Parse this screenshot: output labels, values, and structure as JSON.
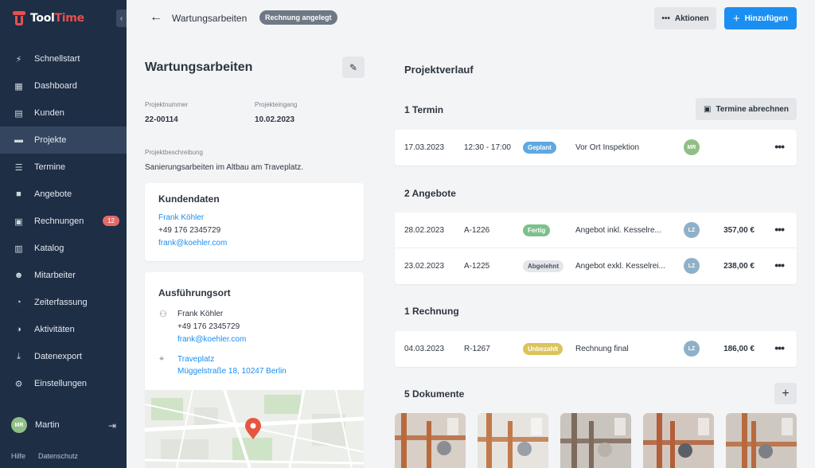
{
  "app": {
    "name_part1": "Tool",
    "name_part2": "Time",
    "brand_color": "#e84f4f",
    "accent_color": "#1b8ef2"
  },
  "sidebar": {
    "items": [
      {
        "label": "Schnellstart",
        "icon": "bolt-icon",
        "glyph": "⚡",
        "active": false
      },
      {
        "label": "Dashboard",
        "icon": "dashboard-icon",
        "glyph": "▦",
        "active": false
      },
      {
        "label": "Kunden",
        "icon": "address-card-icon",
        "glyph": "▤",
        "active": false
      },
      {
        "label": "Projekte",
        "icon": "folder-icon",
        "glyph": "▬",
        "active": true
      },
      {
        "label": "Termine",
        "icon": "list-icon",
        "glyph": "☰",
        "active": false
      },
      {
        "label": "Angebote",
        "icon": "document-icon",
        "glyph": "■",
        "active": false
      },
      {
        "label": "Rechnungen",
        "icon": "invoice-icon",
        "glyph": "▣",
        "active": false,
        "badge": "12"
      },
      {
        "label": "Katalog",
        "icon": "book-icon",
        "glyph": "▥",
        "active": false
      },
      {
        "label": "Mitarbeiter",
        "icon": "users-icon",
        "glyph": "☻",
        "active": false
      },
      {
        "label": "Zeiterfassung",
        "icon": "stopwatch-icon",
        "glyph": "◔",
        "active": false
      },
      {
        "label": "Aktivitäten",
        "icon": "activity-icon",
        "glyph": "◑",
        "active": false
      },
      {
        "label": "Datenexport",
        "icon": "download-icon",
        "glyph": "⤓",
        "active": false
      },
      {
        "label": "Einstellungen",
        "icon": "gear-icon",
        "glyph": "⚙",
        "active": false
      }
    ],
    "user": {
      "initials": "MR",
      "name": "Martin"
    },
    "footer": {
      "help": "Hilfe",
      "privacy": "Datenschutz"
    }
  },
  "header": {
    "title": "Wartungsarbeiten",
    "status": "Rechnung angelegt",
    "actions_label": "Aktionen",
    "add_label": "Hinzufügen"
  },
  "project": {
    "title": "Wartungsarbeiten",
    "number_label": "Projektnummer",
    "number": "22-00114",
    "received_label": "Projekteingang",
    "received": "10.02.2023",
    "description_label": "Projektbeschreibung",
    "description": "Sanierungsarbeiten im Altbau am Traveplatz."
  },
  "customer": {
    "title": "Kundendaten",
    "name": "Frank Köhler",
    "phone": "+49 176 2345729",
    "email": "frank@koehler.com"
  },
  "location": {
    "title": "Ausführungsort",
    "name": "Frank Köhler",
    "phone": "+49 176 2345729",
    "email": "frank@koehler.com",
    "place": "Traveplatz",
    "address": "Müggelstraße 18, 10247 Berlin"
  },
  "history": {
    "title": "Projektverlauf",
    "appointments": {
      "title": "1 Termin",
      "button": "Termine abrechnen",
      "rows": [
        {
          "date": "17.03.2023",
          "time": "12:30 - 17:00",
          "status": "Geplant",
          "status_bg": "#5fa8e0",
          "status_fg": "#ffffff",
          "text": "Vor Ort Inspektion",
          "initials": "MR",
          "avatar": "green"
        }
      ]
    },
    "offers": {
      "title": "2 Angebote",
      "rows": [
        {
          "date": "28.02.2023",
          "number": "A-1226",
          "status": "Fertig",
          "status_bg": "#7cc08a",
          "status_fg": "#ffffff",
          "text": "Angebot inkl. Kesselre...",
          "initials": "LZ",
          "avatar": "blue",
          "amount": "357,00 €"
        },
        {
          "date": "23.02.2023",
          "number": "A-1225",
          "status": "Abgelehnt",
          "status_bg": "#e4e6ea",
          "status_fg": "#4a525d",
          "text": "Angebot exkl. Kesselrei...",
          "initials": "LZ",
          "avatar": "blue",
          "amount": "238,00 €"
        }
      ]
    },
    "invoices": {
      "title": "1 Rechnung",
      "rows": [
        {
          "date": "04.03.2023",
          "number": "R-1267",
          "status": "Unbezahlt",
          "status_bg": "#dcc35a",
          "status_fg": "#ffffff",
          "text": "Rechnung final",
          "initials": "LZ",
          "avatar": "blue",
          "amount": "186,00 €"
        }
      ]
    },
    "documents": {
      "title": "5 Dokumente",
      "count": 5
    }
  }
}
